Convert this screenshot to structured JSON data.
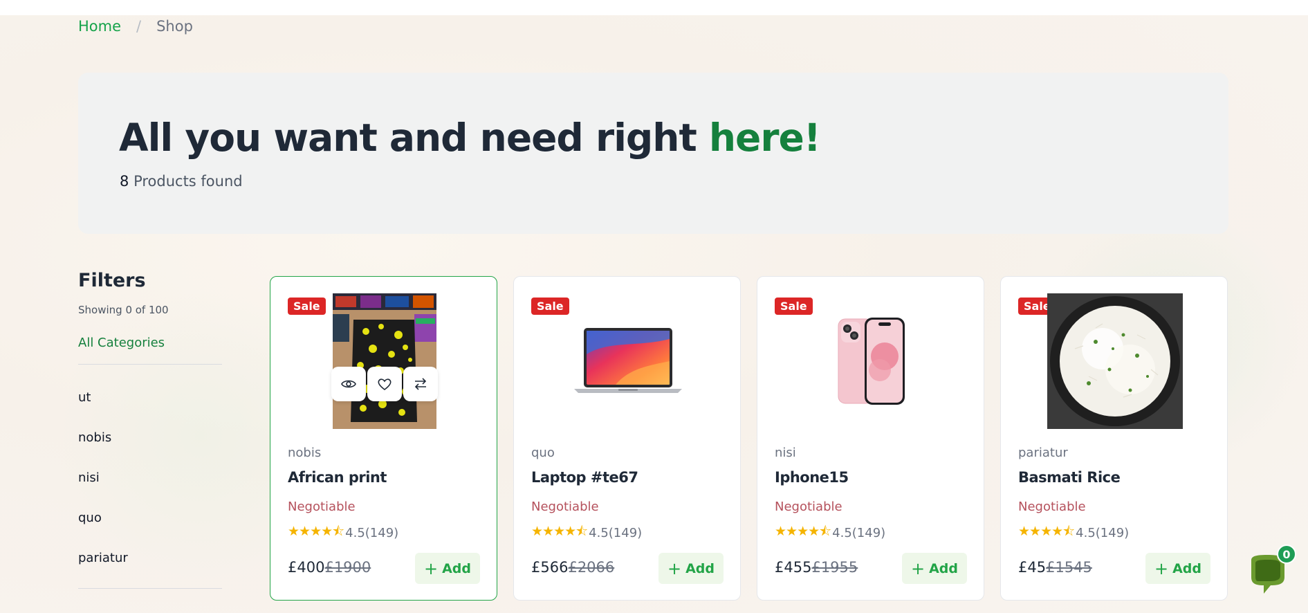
{
  "breadcrumb": {
    "home": "Home",
    "separator": "/",
    "current": "Shop"
  },
  "hero": {
    "title_main": "All you want and need right",
    "title_accent": "here!",
    "count": "8",
    "count_label": "Products found"
  },
  "filters": {
    "title": "Filters",
    "showing": "Showing 0 of 100",
    "all_categories": "All Categories",
    "categories": [
      "ut",
      "nobis",
      "nisi",
      "quo",
      "pariatur"
    ]
  },
  "products": [
    {
      "badge": "Sale",
      "category": "nobis",
      "name": "African print",
      "negotiable": "Negotiable",
      "stars": "★★★★⯪",
      "rating": "4.5",
      "reviews": "(149)",
      "price": "£400",
      "old_price": "£1900",
      "add_label": "Add",
      "image": "fabric-image"
    },
    {
      "badge": "Sale",
      "category": "quo",
      "name": "Laptop #te67",
      "negotiable": "Negotiable",
      "stars": "★★★★⯪",
      "rating": "4.5",
      "reviews": "(149)",
      "price": "£566",
      "old_price": "£2066",
      "add_label": "Add",
      "image": "laptop-image"
    },
    {
      "badge": "Sale",
      "category": "nisi",
      "name": "Iphone15",
      "negotiable": "Negotiable",
      "stars": "★★★★⯪",
      "rating": "4.5",
      "reviews": "(149)",
      "price": "£455",
      "old_price": "£1955",
      "add_label": "Add",
      "image": "phone-image"
    },
    {
      "badge": "Sale",
      "category": "pariatur",
      "name": "Basmati Rice",
      "negotiable": "Negotiable",
      "stars": "★★★★⯪",
      "rating": "4.5",
      "reviews": "(149)",
      "price": "£45",
      "old_price": "£1545",
      "add_label": "Add",
      "image": "rice-image"
    }
  ],
  "quick_actions": [
    "eye-icon",
    "heart-icon",
    "compare-icon"
  ],
  "chat": {
    "badge_count": "0"
  },
  "colors": {
    "accent": "#22a447",
    "sale": "#dc2626",
    "negotiable": "#b5515c",
    "star": "#f5b400"
  }
}
